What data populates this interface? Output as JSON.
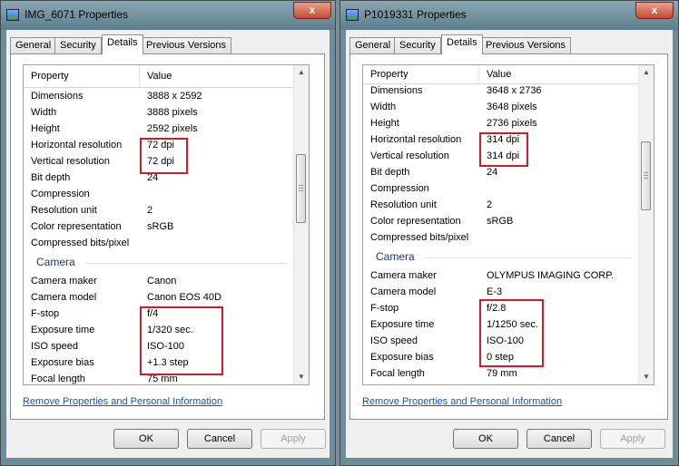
{
  "windows": [
    {
      "title": "IMG_6071 Properties",
      "close_label": "x",
      "tabs": [
        "General",
        "Security",
        "Details",
        "Previous Versions"
      ],
      "active_tab": "Details",
      "columns": [
        "Property",
        "Value"
      ],
      "rows_top": [
        {
          "k": "Dimensions",
          "v": "3888 x 2592"
        },
        {
          "k": "Width",
          "v": "3888 pixels"
        },
        {
          "k": "Height",
          "v": "2592 pixels"
        },
        {
          "k": "Horizontal resolution",
          "v": "72 dpi"
        },
        {
          "k": "Vertical resolution",
          "v": "72 dpi"
        },
        {
          "k": "Bit depth",
          "v": "24"
        },
        {
          "k": "Compression",
          "v": ""
        },
        {
          "k": "Resolution unit",
          "v": "2"
        },
        {
          "k": "Color representation",
          "v": "sRGB"
        },
        {
          "k": "Compressed bits/pixel",
          "v": ""
        }
      ],
      "group_label": "Camera",
      "rows_camera": [
        {
          "k": "Camera maker",
          "v": "Canon"
        },
        {
          "k": "Camera model",
          "v": "Canon EOS 40D"
        },
        {
          "k": "F-stop",
          "v": "f/4"
        },
        {
          "k": "Exposure time",
          "v": "1/320 sec."
        },
        {
          "k": "ISO speed",
          "v": "ISO-100"
        },
        {
          "k": "Exposure bias",
          "v": "+1.3 step"
        },
        {
          "k": "Focal length",
          "v": "75 mm"
        }
      ],
      "link": "Remove Properties and Personal Information",
      "buttons": {
        "ok": "OK",
        "cancel": "Cancel",
        "apply": "Apply"
      }
    },
    {
      "title": "P1019331 Properties",
      "close_label": "x",
      "tabs": [
        "General",
        "Security",
        "Details",
        "Previous Versions"
      ],
      "active_tab": "Details",
      "columns": [
        "Property",
        "Value"
      ],
      "rows_top": [
        {
          "k": "Dimensions",
          "v": "3648 x 2736"
        },
        {
          "k": "Width",
          "v": "3648 pixels"
        },
        {
          "k": "Height",
          "v": "2736 pixels"
        },
        {
          "k": "Horizontal resolution",
          "v": "314 dpi"
        },
        {
          "k": "Vertical resolution",
          "v": "314 dpi"
        },
        {
          "k": "Bit depth",
          "v": "24"
        },
        {
          "k": "Compression",
          "v": ""
        },
        {
          "k": "Resolution unit",
          "v": "2"
        },
        {
          "k": "Color representation",
          "v": "sRGB"
        },
        {
          "k": "Compressed bits/pixel",
          "v": ""
        }
      ],
      "group_label": "Camera",
      "rows_camera": [
        {
          "k": "Camera maker",
          "v": "OLYMPUS IMAGING CORP."
        },
        {
          "k": "Camera model",
          "v": "E-3"
        },
        {
          "k": "F-stop",
          "v": "f/2.8"
        },
        {
          "k": "Exposure time",
          "v": "1/1250 sec."
        },
        {
          "k": "ISO speed",
          "v": "ISO-100"
        },
        {
          "k": "Exposure bias",
          "v": "0 step"
        },
        {
          "k": "Focal length",
          "v": "79 mm"
        }
      ],
      "link": "Remove Properties and Personal Information",
      "buttons": {
        "ok": "OK",
        "cancel": "Cancel",
        "apply": "Apply"
      }
    }
  ],
  "colors": {
    "highlight": "#cc1d2a",
    "link": "#1a55a8",
    "group_header": "#1e3287"
  }
}
